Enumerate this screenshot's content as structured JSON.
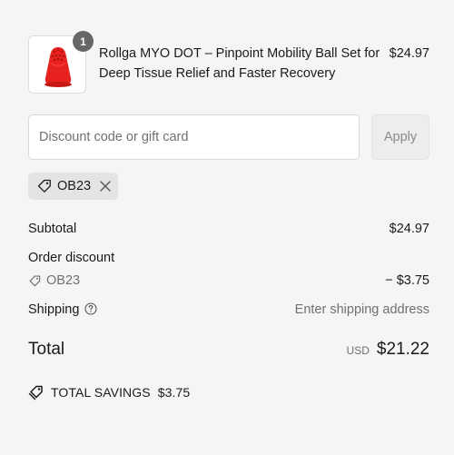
{
  "line_item": {
    "quantity": "1",
    "title": "Rollga MYO DOT – Pinpoint Mobility Ball Set for Deep Tissue Relief and Faster Recovery",
    "price": "$24.97",
    "product_color": "#e8221e"
  },
  "discount": {
    "placeholder": "Discount code or gift card",
    "value": "",
    "apply_label": "Apply",
    "applied_code": "OB23"
  },
  "summary": {
    "subtotal_label": "Subtotal",
    "subtotal_value": "$24.97",
    "order_discount_label": "Order discount",
    "discount_code": "OB23",
    "discount_value": "− $3.75",
    "shipping_label": "Shipping",
    "shipping_value": "Enter shipping address"
  },
  "total": {
    "label": "Total",
    "currency": "USD",
    "amount": "$21.22"
  },
  "savings": {
    "label": "TOTAL SAVINGS",
    "amount": "$3.75"
  }
}
